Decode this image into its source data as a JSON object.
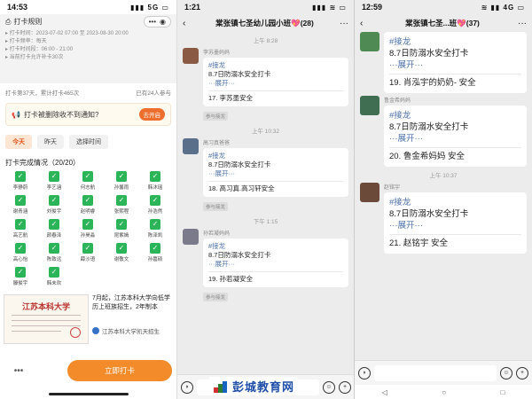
{
  "panel1": {
    "status": {
      "time": "14:53",
      "icons": "▮▮▮ 5G ▭"
    },
    "title": "打卡规则",
    "meta_lines": [
      "▸ 打卡时间：2023-07-02 07:00 至 2023-08-30 20:00",
      "▸ 打卡频率：每天",
      "▸ 打卡时间段：06:00 - 21:00",
      "▸ 当前打卡允许补卡30次"
    ],
    "stats_left": "打卡第37天，累计打卡465次",
    "stats_right": "已有24人参与",
    "notice_text": "打卡被删除收不到通知?",
    "notice_btn": "去开启",
    "tabs": [
      "今天",
      "昨天",
      "选择时间"
    ],
    "section_title": "打卡完成情况（20/20）",
    "members": [
      "李静蔚",
      "李艺涵",
      "何志航",
      "孙馨雨",
      "韩沐瑶",
      "谢青涵",
      "刘俊宇",
      "赵明睿",
      "张熙程",
      "孙浩然",
      "高艺航",
      "颜春泽",
      "孙昊淼",
      "昆紫嫣",
      "陈泽凯",
      "高心怡",
      "陈致远",
      "薛沙语",
      "谢敬文",
      "孙嘉硕",
      "滕俊宇",
      "韩未欢"
    ],
    "ad_title": "江苏本科大学",
    "ad_text": "7月起，江苏本科大学向低学历上班族招生，2年制本",
    "ad_source": "江苏本科大学凯天招生",
    "more": "•••",
    "button": "立即打卡"
  },
  "panel2": {
    "status": {
      "time": "1:21",
      "icons": "▮▮▮ ≋ ▭"
    },
    "title": "棠张镇七圣幼儿园小班💖(28)",
    "messages": [
      {
        "time": "上午 8:28",
        "sender": "李苏墨妈妈",
        "tag": "#接龙",
        "line1": "8.7日防溺水安全打卡",
        "expand": "···展开···",
        "entry": "17. 李苏墨安全",
        "chip": "参与接龙"
      },
      {
        "time": "上午 10:32",
        "sender": "高习真爸爸",
        "tag": "#接龙",
        "line1": "8.7日防溺水安全打卡",
        "expand": "···展开···",
        "entry": "18. 高习真.高习轩安全",
        "chip": "参与接龙"
      },
      {
        "time": "下午 1:15",
        "sender": "孙若凝妈妈",
        "tag": "#接龙",
        "line1": "8.7日防溺水安全打卡",
        "expand": "···展开···",
        "entry": "19. 孙若凝安全",
        "chip": "参与接龙"
      }
    ]
  },
  "panel3": {
    "status": {
      "time": "12:59",
      "icons": "≋ ▮▮ 4G ▭"
    },
    "title": "棠张镇七圣...班💖(37)",
    "messages": [
      {
        "time": "",
        "sender": "",
        "tag": "#接龙",
        "line1": "8.7日防溺水安全打卡",
        "expand": "···展开···",
        "entry": "19. 肖泓宇的奶奶-        安全"
      },
      {
        "time": "",
        "sender": "鲁金希妈妈",
        "tag": "#接龙",
        "line1": "8.7日防溺水安全打卡",
        "expand": "···展开···",
        "entry": "20. 鲁金希妈妈          安全"
      },
      {
        "time": "上午 10:37",
        "sender": "赵铭宇",
        "tag": "#接龙",
        "line1": "8.7日防溺水安全打卡",
        "expand": "···展开···",
        "entry": "21. 赵铭宇              安全"
      }
    ],
    "nav": [
      "◁",
      "○",
      "□"
    ]
  },
  "watermark": "彭城教育网",
  "colors": {
    "accent": "#f38b2a",
    "check": "#2cb458",
    "link": "#4a6fa8"
  }
}
